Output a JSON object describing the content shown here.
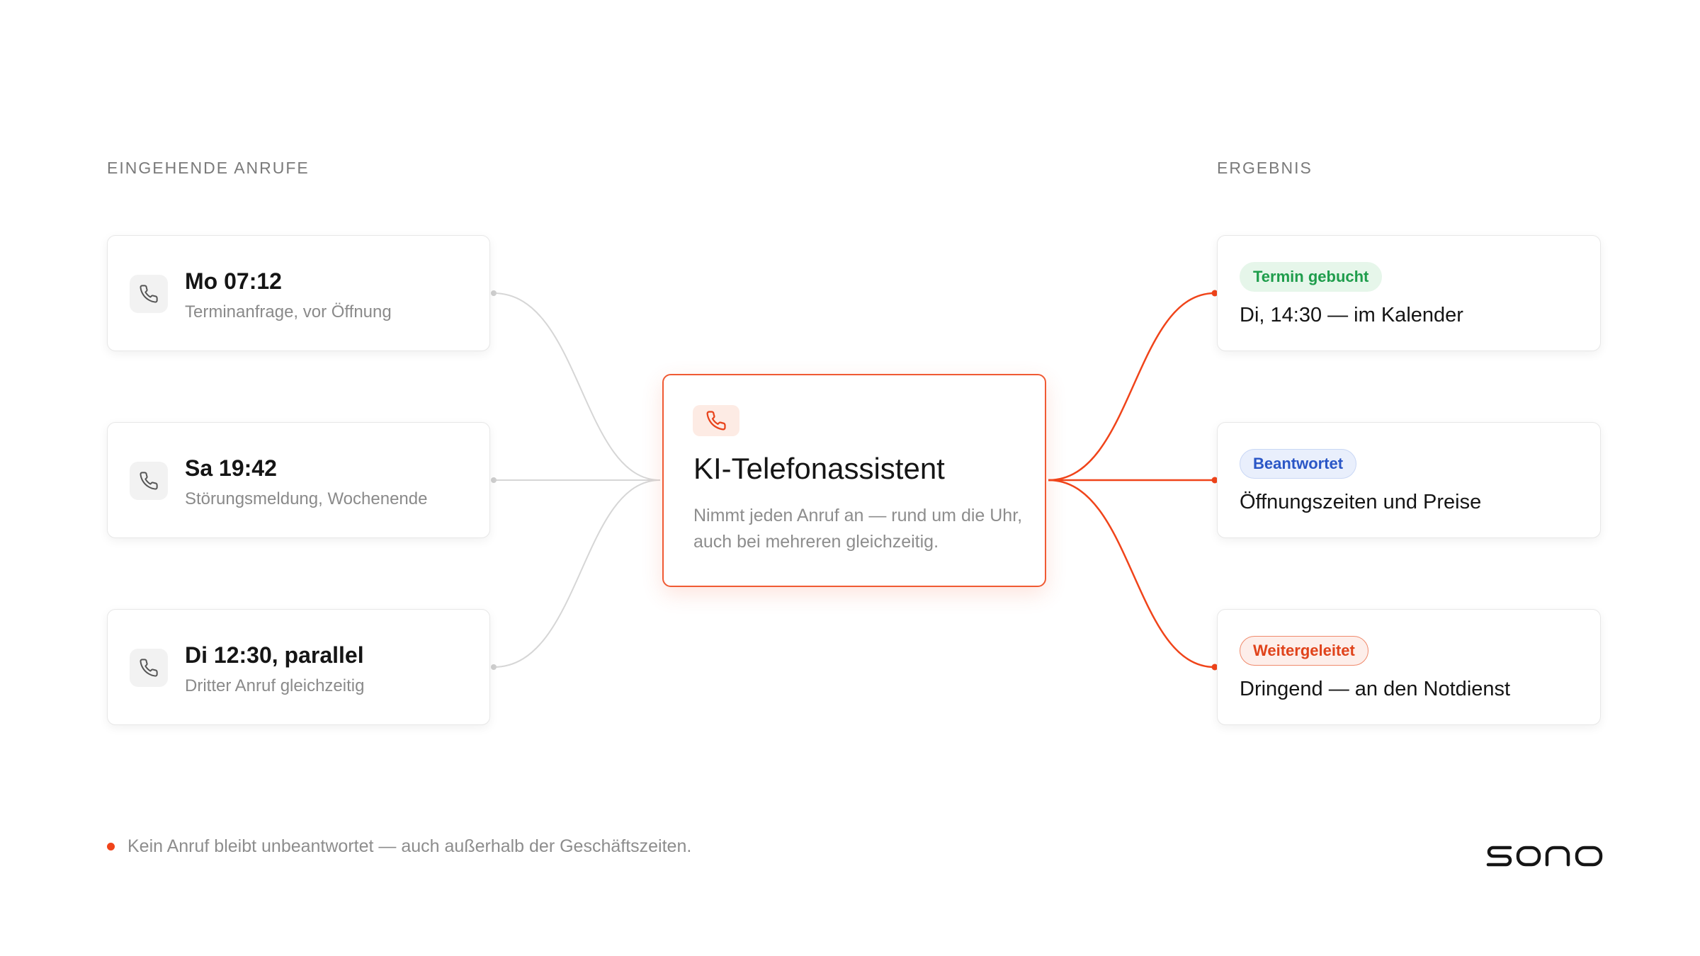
{
  "left_column": {
    "label": "EINGEHENDE ANRUFE",
    "calls": [
      {
        "time": "Mo 07:12",
        "description": "Terminanfrage, vor Öffnung",
        "icon": "phone-icon"
      },
      {
        "time": "Sa 19:42",
        "description": "Störungsmeldung, Wochenende",
        "icon": "phone-icon"
      },
      {
        "time": "Di 12:30, parallel",
        "description": "Dritter Anruf gleichzeitig",
        "icon": "phone-icon"
      }
    ]
  },
  "center": {
    "icon": "phone-icon",
    "title": "KI-Telefonassistent",
    "description": "Nimmt jeden Anruf an — rund um die Uhr, auch bei mehreren gleichzeitig."
  },
  "right_column": {
    "label": "ERGEBNIS",
    "results": [
      {
        "badge": "Termin gebucht",
        "text": "Di, 14:30 — im Kalender",
        "badge_color": "#1f9d4c",
        "badge_bg": "#e6f6ea",
        "badge_border": "#e6f6ea"
      },
      {
        "badge": "Beantwortet",
        "text": "Öffnungszeiten und Preise",
        "badge_color": "#2a56c6",
        "badge_bg": "#e9effc",
        "badge_border": "#c9d7f5"
      },
      {
        "badge": "Weitergeleitet",
        "text": "Dringend — an den Notdienst",
        "badge_color": "#e0431b",
        "badge_bg": "#fdeeea",
        "badge_border": "#f08a6c"
      }
    ]
  },
  "footer": {
    "note": "Kein Anruf bleibt unbeantwortet — auch außerhalb der Geschäftszeiten."
  },
  "brand": {
    "logo_text": "sono"
  },
  "colors": {
    "accent": "#f0441a",
    "connector_grey": "#d6d6d6",
    "text_dark": "#151515",
    "text_muted": "#8d8d8d"
  }
}
